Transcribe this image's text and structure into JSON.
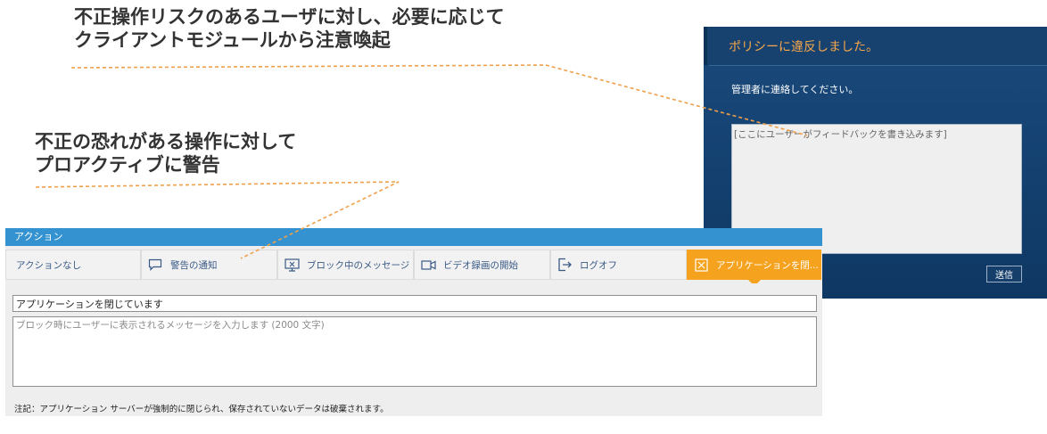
{
  "callouts": [
    {
      "line1": "不正操作リスクのあるユーザに対し、必要に応じて",
      "line2": "クライアントモジュールから注意喚起"
    },
    {
      "line1": "不正の恐れがある操作に対して",
      "line2": "プロアクティブに警告"
    }
  ],
  "colors": {
    "annotation_line": "#f0a04b",
    "dialog_bg": "#13406f",
    "dialog_title": "#f5a64a",
    "panel_header": "#3392cf",
    "active_tab": "#f5a21f",
    "tab_text": "#3a5a86"
  },
  "dialog": {
    "title": "ポリシーに違反しました。",
    "message": "管理者に連絡してください。",
    "feedback_placeholder": "[ここにユーザーがフィードバックを書き込みます]",
    "send_label": "送信"
  },
  "action_panel": {
    "header": "アクション",
    "tabs": [
      {
        "label": "アクションなし",
        "icon": "",
        "active": false
      },
      {
        "label": "警告の通知",
        "icon": "speech-bubble-icon",
        "active": false
      },
      {
        "label": "ブロック中のメッセージ",
        "icon": "monitor-block-icon",
        "active": false
      },
      {
        "label": "ビデオ録画の開始",
        "icon": "video-camera-icon",
        "active": false
      },
      {
        "label": "ログオフ",
        "icon": "logoff-icon",
        "active": false
      },
      {
        "label": "アプリケーションを閉...",
        "icon": "close-box-icon",
        "active": true
      }
    ],
    "title_value": "アプリケーションを閉じています",
    "message_placeholder": "ブロック時にユーザーに表示されるメッセージを入力します (2000 文字)",
    "note": "注記：アプリケーション サーバーが強制的に閉じられ、保存されていないデータは破棄されます。"
  }
}
